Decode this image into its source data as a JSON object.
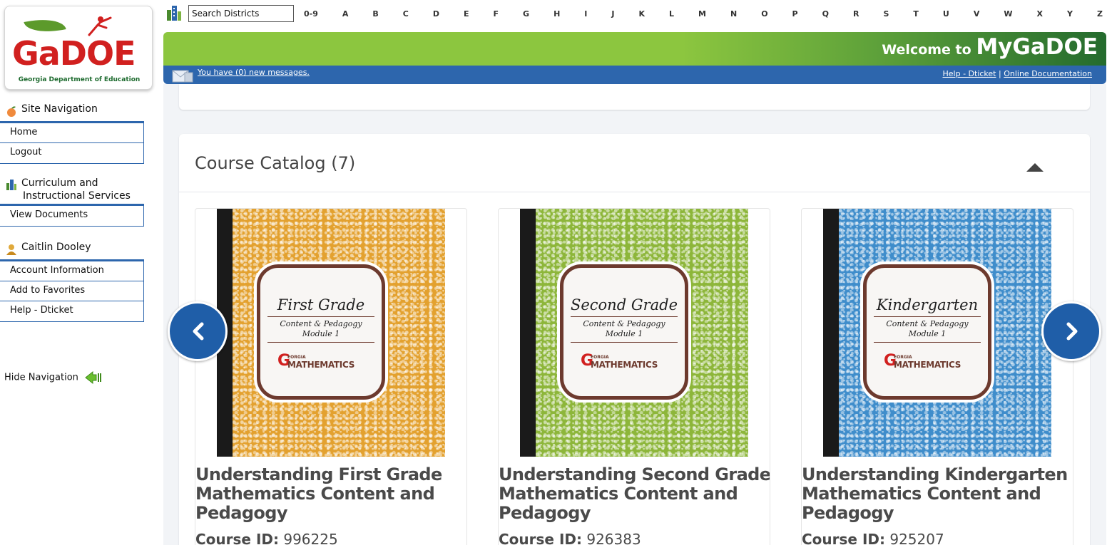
{
  "logo": {
    "wordmark": "GaDOE",
    "subtitle": "Georgia Department of Education"
  },
  "search": {
    "placeholder": "Search Districts"
  },
  "alphabet": [
    "0-9",
    "A",
    "B",
    "C",
    "D",
    "E",
    "F",
    "G",
    "H",
    "I",
    "J",
    "K",
    "L",
    "M",
    "N",
    "O",
    "P",
    "Q",
    "R",
    "S",
    "T",
    "U",
    "V",
    "W",
    "X",
    "Y",
    "Z"
  ],
  "banner": {
    "welcome_prefix": "Welcome to ",
    "welcome_brand": "MyGaDOE"
  },
  "messages": {
    "text": "You have (0) new messages.",
    "help_link": "Help - Dticket",
    "separator": "|",
    "docs_link": "Online Documentation"
  },
  "sidebar": {
    "sections": [
      {
        "heading": "Site Navigation",
        "icon": "peach-icon",
        "items": [
          "Home",
          "Logout"
        ]
      },
      {
        "heading": "Curriculum and Instructional Services",
        "heading_line1": "Curriculum and",
        "heading_line2": "Instructional Services",
        "icon": "building-icon",
        "items": [
          "View Documents"
        ]
      },
      {
        "heading": "Caitlin Dooley",
        "icon": "user-icon",
        "items": [
          "Account Information",
          "Add to Favorites",
          "Help - Dticket"
        ]
      }
    ],
    "hide_label": "Hide Navigation"
  },
  "catalog": {
    "title": "Course Catalog (7)",
    "id_label": "Course ID:",
    "cover_sub_line1": "Content & Pedagogy",
    "cover_sub_line2": "Module 1",
    "cover_badge_georgia": "EORGIA",
    "cover_badge_math": "MATHEMATICS",
    "courses": [
      {
        "cover_grade": "First Grade",
        "title": "Understanding First Grade Mathematics Content and Pedagogy",
        "course_id": "996225",
        "color": "#e3a12f"
      },
      {
        "cover_grade": "Second Grade",
        "title": "Understanding Second Grade Mathematics Content and Pedagogy",
        "course_id": "926383",
        "color": "#8db63a"
      },
      {
        "cover_grade": "Kindergarten",
        "title": "Understanding Kindergarten Mathematics Content and Pedagogy",
        "course_id": "925207",
        "color": "#3f8dcb"
      }
    ]
  },
  "colors": {
    "brand_blue": "#2d66ad",
    "banner_green": "#8cc63f",
    "logo_red": "#d1201f",
    "carousel_blue": "#1f5ea8"
  }
}
